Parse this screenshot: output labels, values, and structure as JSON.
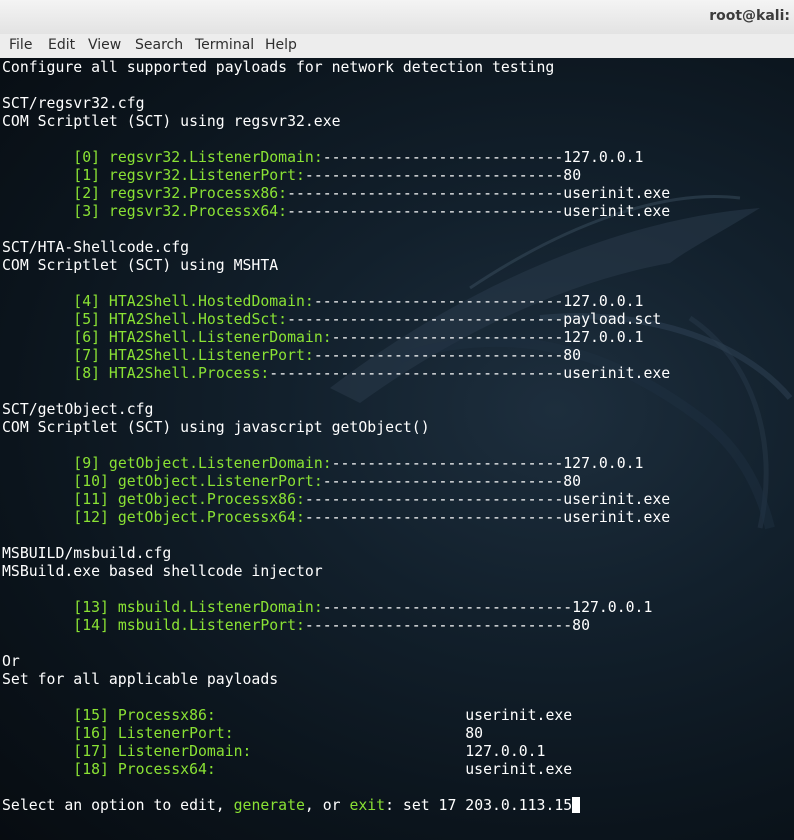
{
  "window": {
    "title": "root@kali:"
  },
  "menu": [
    "File",
    "Edit",
    "View",
    "Search",
    "Terminal",
    "Help"
  ],
  "terminal": {
    "header": "Configure all supported payloads for network detection testing",
    "sections": [
      {
        "title": "SCT/regsvr32.cfg",
        "description": "COM Scriptlet (SCT) using regsvr32.exe",
        "options": [
          {
            "index": "[0]",
            "name": "regsvr32.ListenerDomain:",
            "dashes": "---------------------------",
            "value": "127.0.0.1"
          },
          {
            "index": "[1]",
            "name": "regsvr32.ListenerPort:",
            "dashes": "-----------------------------",
            "value": "80"
          },
          {
            "index": "[2]",
            "name": "regsvr32.Processx86:",
            "dashes": "-------------------------------",
            "value": "userinit.exe"
          },
          {
            "index": "[3]",
            "name": "regsvr32.Processx64:",
            "dashes": "-------------------------------",
            "value": "userinit.exe"
          }
        ]
      },
      {
        "title": "SCT/HTA-Shellcode.cfg",
        "description": "COM Scriptlet (SCT) using MSHTA",
        "options": [
          {
            "index": "[4]",
            "name": "HTA2Shell.HostedDomain:",
            "dashes": "----------------------------",
            "value": "127.0.0.1"
          },
          {
            "index": "[5]",
            "name": "HTA2Shell.HostedSct:",
            "dashes": "-------------------------------",
            "value": "payload.sct"
          },
          {
            "index": "[6]",
            "name": "HTA2Shell.ListenerDomain:",
            "dashes": "--------------------------",
            "value": "127.0.0.1"
          },
          {
            "index": "[7]",
            "name": "HTA2Shell.ListenerPort:",
            "dashes": "----------------------------",
            "value": "80"
          },
          {
            "index": "[8]",
            "name": "HTA2Shell.Process:",
            "dashes": "---------------------------------",
            "value": "userinit.exe"
          }
        ]
      },
      {
        "title": "SCT/getObject.cfg",
        "description": "COM Scriptlet (SCT) using javascript getObject()",
        "options": [
          {
            "index": "[9]",
            "name": "getObject.ListenerDomain:",
            "dashes": "--------------------------",
            "value": "127.0.0.1"
          },
          {
            "index": "[10]",
            "name": "getObject.ListenerPort:",
            "dashes": "---------------------------",
            "value": "80"
          },
          {
            "index": "[11]",
            "name": "getObject.Processx86:",
            "dashes": "-----------------------------",
            "value": "userinit.exe"
          },
          {
            "index": "[12]",
            "name": "getObject.Processx64:",
            "dashes": "-----------------------------",
            "value": "userinit.exe"
          }
        ]
      },
      {
        "title": "MSBUILD/msbuild.cfg",
        "description": "MSBuild.exe based shellcode injector",
        "options": [
          {
            "index": "[13]",
            "name": "msbuild.ListenerDomain:",
            "dashes": "----------------------------",
            "value": "127.0.0.1"
          },
          {
            "index": "[14]",
            "name": "msbuild.ListenerPort:",
            "dashes": "------------------------------",
            "value": "80"
          }
        ]
      }
    ],
    "or_text": "Or",
    "global_title": "Set for all applicable payloads",
    "global_options": [
      {
        "index": "[15]",
        "name": "Processx86:",
        "value": "userinit.exe"
      },
      {
        "index": "[16]",
        "name": "ListenerPort:",
        "value": "80"
      },
      {
        "index": "[17]",
        "name": "ListenerDomain:",
        "value": "127.0.0.1"
      },
      {
        "index": "[18]",
        "name": "Processx64:",
        "value": "userinit.exe"
      }
    ],
    "prompt": {
      "prefix": "Select an option to edit, ",
      "generate": "generate",
      "middle": ", or ",
      "exit": "exit",
      "suffix": ": ",
      "input": "set 17 203.0.113.15"
    }
  },
  "colors": {
    "green": "#8ae234",
    "white": "#ffffff",
    "background": "#0c1116"
  }
}
